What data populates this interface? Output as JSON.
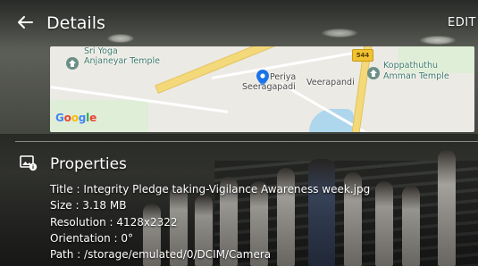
{
  "header": {
    "title": "Details",
    "edit_label": "EDIT"
  },
  "map": {
    "labels": {
      "sri_yoga_line1": "Sri Yoga",
      "sri_yoga_line2": "Anjaneyar Temple",
      "peria_line1": "Periya",
      "peria_line2": "Seeragapadi",
      "veerapandi": "Veerapandi",
      "koppathu_line1": "Koppathuthu",
      "koppathu_line2": "Amman Temple",
      "highway": "544"
    },
    "attribution": [
      "G",
      "o",
      "o",
      "g",
      "l",
      "e"
    ]
  },
  "properties": {
    "heading": "Properties",
    "title_line": "Title : Integrity Pledge taking-Vigilance Awareness week.jpg",
    "size_line": "Size : 3.18 MB",
    "resolution_line": "Resolution : 4128x2322",
    "orientation_line": "Orientation : 0°",
    "path_line": "Path : /storage/emulated/0/DCIM/Camera"
  },
  "colors": {
    "map_background": "#eceae4",
    "road": "#f3d97a",
    "poi": "#3c7a6c",
    "pin": "#1a73e8"
  },
  "icons": [
    "back-arrow-icon",
    "temple-poi-icon",
    "location-pin-icon",
    "image-info-icon"
  ]
}
